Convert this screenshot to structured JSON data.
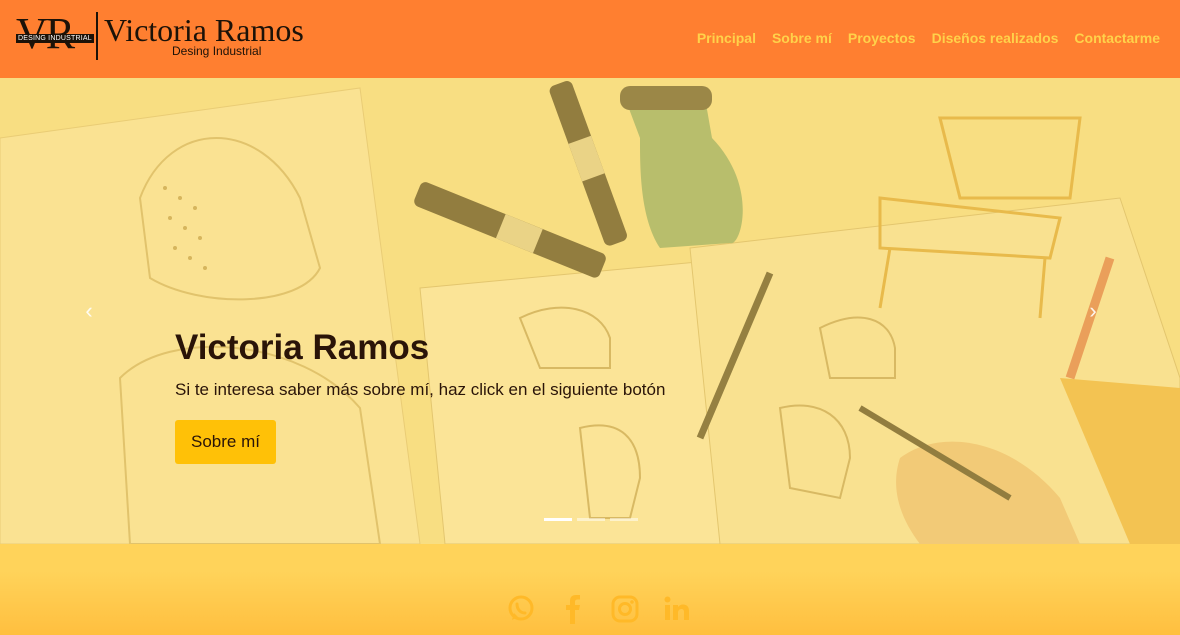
{
  "header": {
    "logo_initials": "VR",
    "logo_tag": "DESING INDUSTRIAL",
    "logo_name": "Victoria Ramos",
    "logo_subtitle": "Desing Industrial",
    "nav": [
      "Principal",
      "Sobre mí",
      "Proyectos",
      "Diseños realizados",
      "Contactarme"
    ]
  },
  "hero": {
    "title": "Victoria Ramos",
    "text": "Si te interesa saber más sobre mí, haz click en el siguiente botón",
    "button": "Sobre mí",
    "prev_icon": "chevron-left-icon",
    "next_icon": "chevron-right-icon",
    "slides": 3,
    "active_slide": 1
  },
  "footer": {
    "social": [
      "whatsapp-icon",
      "facebook-icon",
      "instagram-icon",
      "linkedin-icon"
    ]
  },
  "colors": {
    "header_bg": "#ff7f30",
    "nav_text": "#ffd24a",
    "button_bg": "#ffc107",
    "footer_bg": "#ffd35a",
    "icon": "#ffb928"
  }
}
